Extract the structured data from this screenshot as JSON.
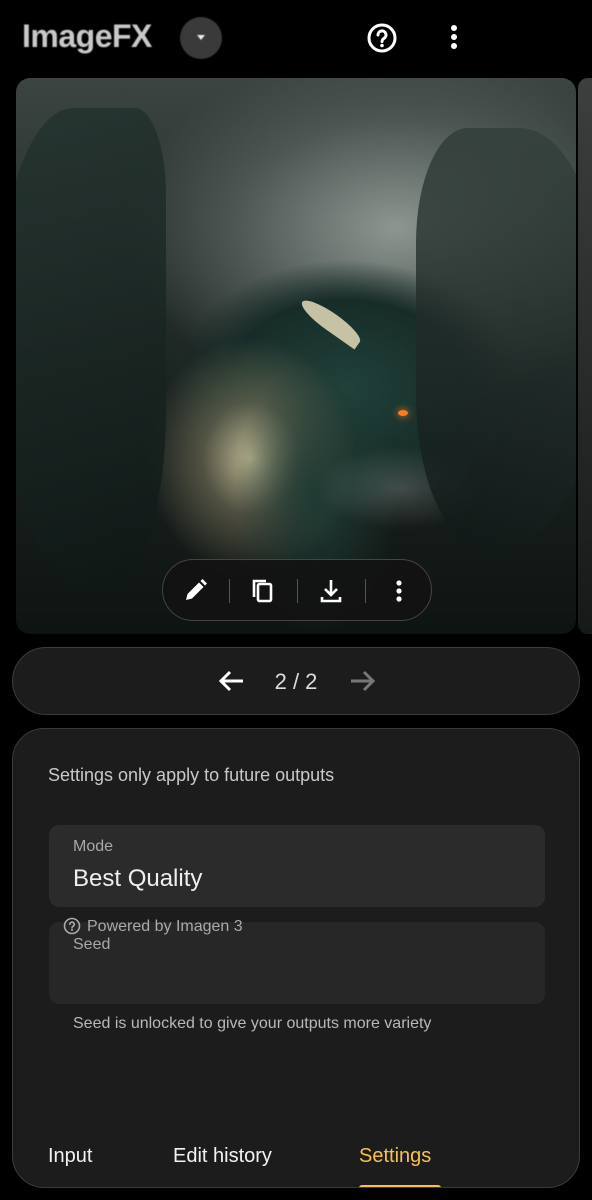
{
  "header": {
    "app_name": "ImageFX",
    "dropdown_icon": "chevron-down-icon",
    "help_icon": "help-circle-icon",
    "more_icon": "more-vert-icon"
  },
  "image_toolbar": {
    "buttons": [
      "edit-pencil-icon",
      "copy-icon",
      "download-icon",
      "more-vert-icon"
    ]
  },
  "pager": {
    "count": "2 / 2",
    "prev_icon": "arrow-left-icon",
    "next_icon": "arrow-right-icon"
  },
  "settings": {
    "note": "Settings only apply to future outputs",
    "mode_label": "Mode",
    "mode_value": "Best Quality",
    "powered_by": "Powered by Imagen 3",
    "seed_label": "Seed",
    "seed_note": "Seed is unlocked to give your outputs more variety"
  },
  "tabs": [
    {
      "label": "Input"
    },
    {
      "label": "Edit history"
    },
    {
      "label": "Settings",
      "active": true
    }
  ],
  "colors": {
    "accent": "#f6c24b",
    "background": "#000000",
    "panel": "#1c1c1c"
  }
}
